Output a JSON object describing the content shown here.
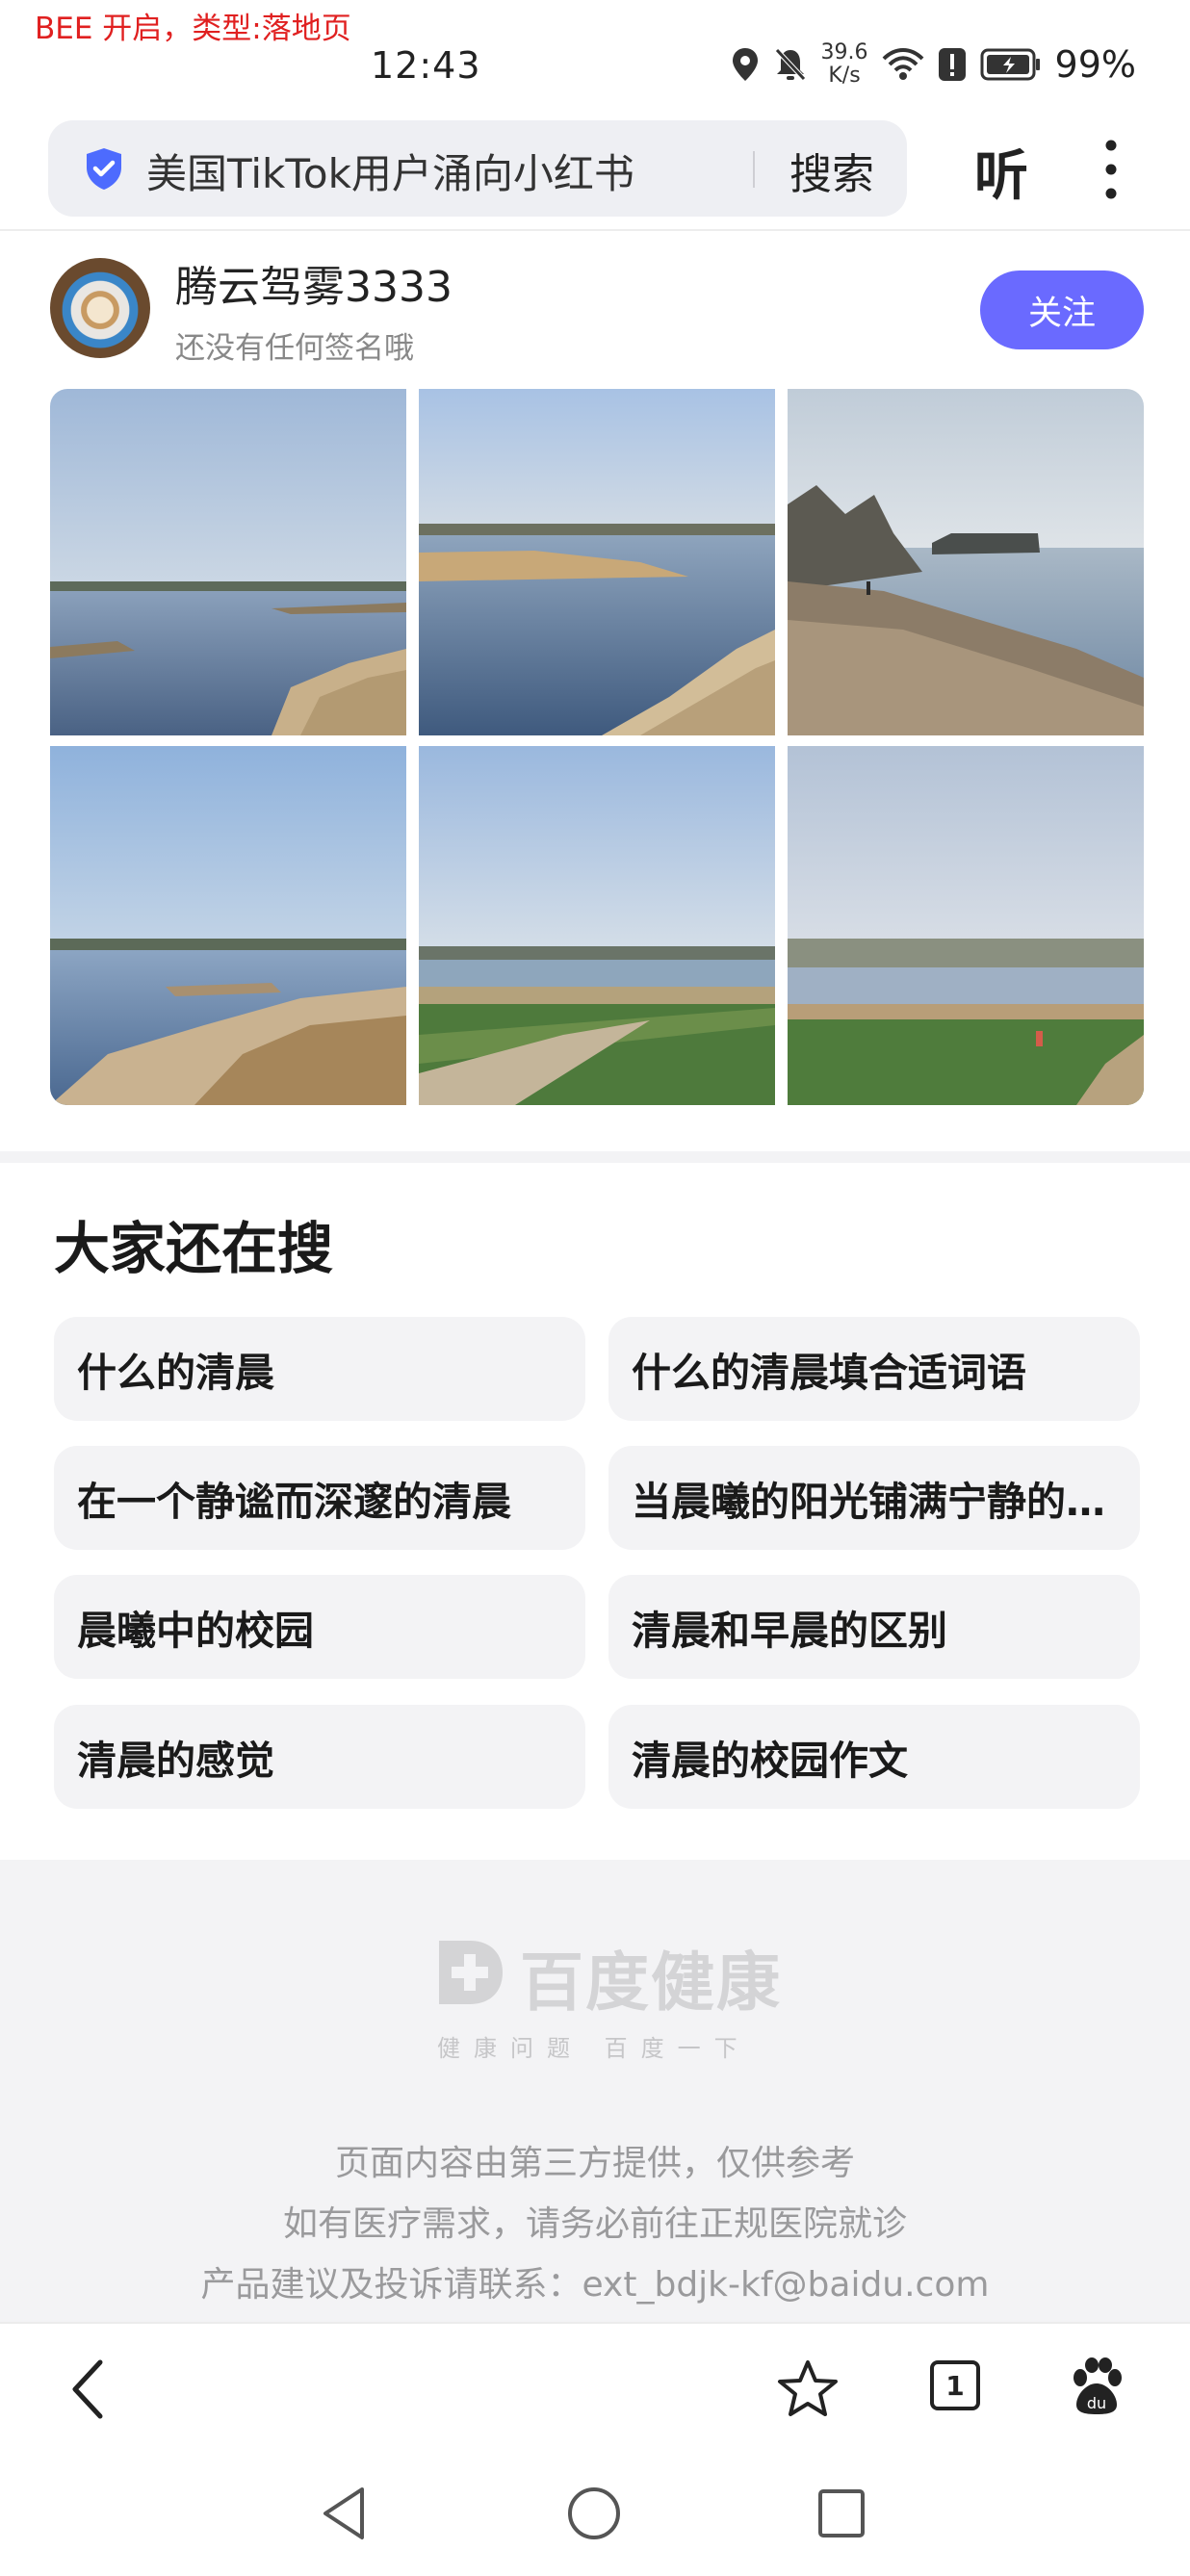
{
  "debug_label": "BEE 开启，类型:落地页",
  "status_bar": {
    "time": "12:43",
    "net_speed_value": "39.6",
    "net_speed_unit": "K/s",
    "battery": "99%",
    "icons": [
      "location-icon",
      "mute-bell-icon",
      "wifi-icon",
      "alert-icon",
      "battery-charging-icon"
    ]
  },
  "search": {
    "query": "美国TikTok用户涌向小红书",
    "button": "搜索",
    "listen": "听"
  },
  "author": {
    "name": "腾云驾雾3333",
    "bio": "还没有任何签名哦",
    "follow_label": "关注"
  },
  "photos": [
    "lake-sandbar",
    "lake-sandbank",
    "lakeshore-person",
    "lake-reeds",
    "wheat-field-path",
    "wheat-field-lake"
  ],
  "related": {
    "title": "大家还在搜",
    "items": [
      "什么的清晨",
      "什么的清晨填合适词语",
      "在一个静谧而深邃的清晨",
      "当晨曦的阳光铺满宁静的…",
      "晨曦中的校园",
      "清晨和早晨的区别",
      "清晨的感觉",
      "清晨的校园作文"
    ]
  },
  "footer": {
    "logo_text": "百度健康",
    "logo_sub": "健康问题 百度一下",
    "lines": [
      "页面内容由第三方提供，仅供参考",
      "如有医疗需求，请务必前往正规医院就诊",
      "产品建议及投诉请联系：ext_bdjk-kf@baidu.com"
    ]
  },
  "bottom_nav": {
    "tab_count": "1"
  },
  "colors": {
    "accent": "#6a6aff",
    "shield": "#4d6bfe",
    "debug": "#e02020"
  }
}
